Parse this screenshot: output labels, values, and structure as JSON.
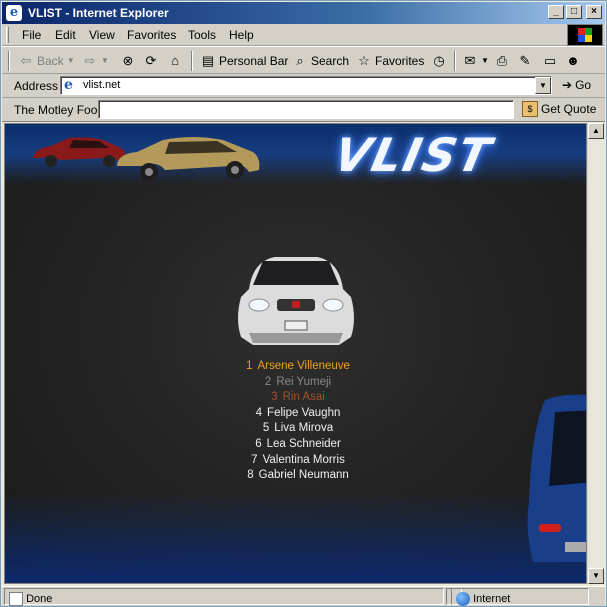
{
  "window": {
    "title": "VLIST - Internet Explorer"
  },
  "menu": {
    "items": [
      "File",
      "Edit",
      "View",
      "Favorites",
      "Tools",
      "Help"
    ]
  },
  "toolbar": {
    "back_label": "Back",
    "personal_bar_label": "Personal Bar",
    "search_label": "Search",
    "favorites_label": "Favorites"
  },
  "address": {
    "label": "Address",
    "value": "vlist.net",
    "go_label": "Go"
  },
  "links": {
    "label": "The Motley Fool",
    "input_value": "",
    "button_label": "Get Quote"
  },
  "page": {
    "logo_text": "VLIST",
    "roster": [
      {
        "num": "1",
        "name": "Arsene Villeneuve",
        "color": "#f0a020"
      },
      {
        "num": "2",
        "name": "Rei Yumeji",
        "color": "#8a8a8a"
      },
      {
        "num": "3",
        "name": "Rin Asai",
        "color": "#a0522d"
      },
      {
        "num": "4",
        "name": "Felipe Vaughn",
        "color": "#f0f0f0"
      },
      {
        "num": "5",
        "name": "Liva Mirova",
        "color": "#f0f0f0"
      },
      {
        "num": "6",
        "name": "Lea Schneider",
        "color": "#f0f0f0"
      },
      {
        "num": "7",
        "name": "Valentina Morris",
        "color": "#f0f0f0"
      },
      {
        "num": "8",
        "name": "Gabriel Neumann",
        "color": "#f0f0f0"
      }
    ]
  },
  "status": {
    "text": "Done",
    "zone": "Internet"
  },
  "colors": {
    "banner": "#0b2e6b",
    "logo_glow": "#6aa6ff",
    "gold": "#f0a020",
    "bronze": "#a0522d",
    "silver": "#8a8a8a"
  },
  "icons": [
    "ie-icon",
    "back-arrow-icon",
    "forward-arrow-icon",
    "stop-icon",
    "refresh-icon",
    "home-icon",
    "search-icon",
    "favorites-icon",
    "history-icon",
    "mail-icon",
    "print-icon",
    "edit-icon",
    "discuss-icon",
    "messenger-icon",
    "go-icon",
    "quote-icon",
    "globe-icon"
  ]
}
